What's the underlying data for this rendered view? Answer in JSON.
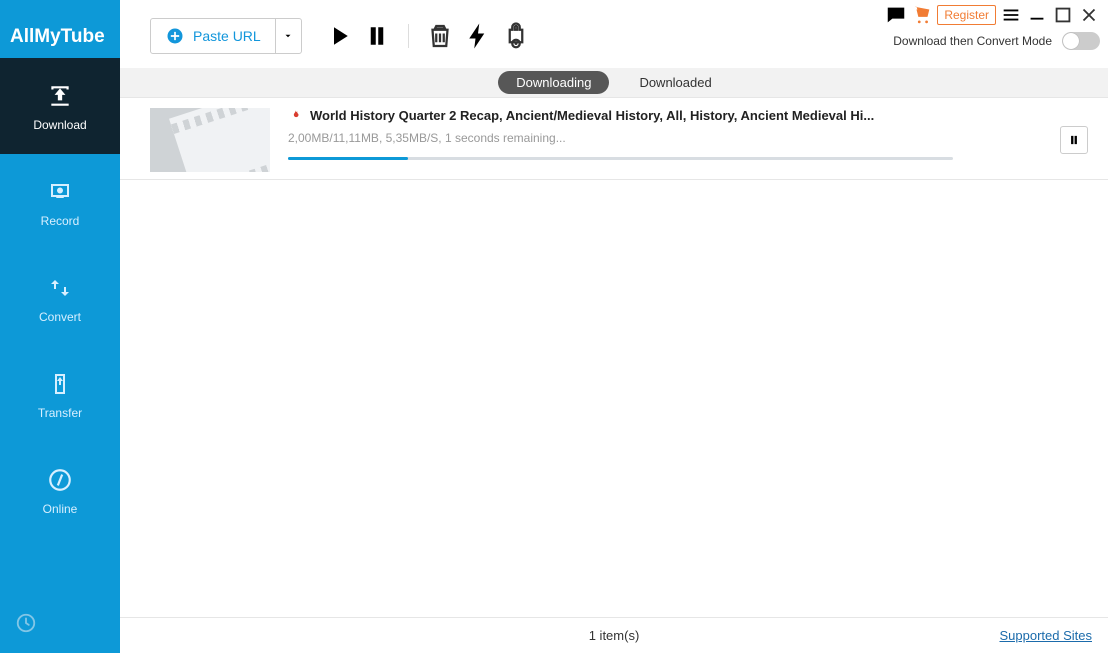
{
  "app": {
    "name": "AllMyTube"
  },
  "sidebar": {
    "items": [
      {
        "label": "Download"
      },
      {
        "label": "Record"
      },
      {
        "label": "Convert"
      },
      {
        "label": "Transfer"
      },
      {
        "label": "Online"
      }
    ]
  },
  "titlebar": {
    "register_label": "Register"
  },
  "subheader": {
    "mode_label": "Download then Convert Mode"
  },
  "toolbar": {
    "paste_label": "Paste URL"
  },
  "tabs": {
    "downloading": "Downloading",
    "downloaded": "Downloaded"
  },
  "downloads": [
    {
      "title": "World History Quarter 2 Recap, Ancient/Medieval History, All, History, Ancient Medieval Hi...",
      "progress_text": "2,00MB/11,11MB, 5,35MB/S, 1 seconds remaining...",
      "progress_pct": 18
    }
  ],
  "status": {
    "count_text": "1 item(s)",
    "supported_sites": "Supported Sites"
  }
}
